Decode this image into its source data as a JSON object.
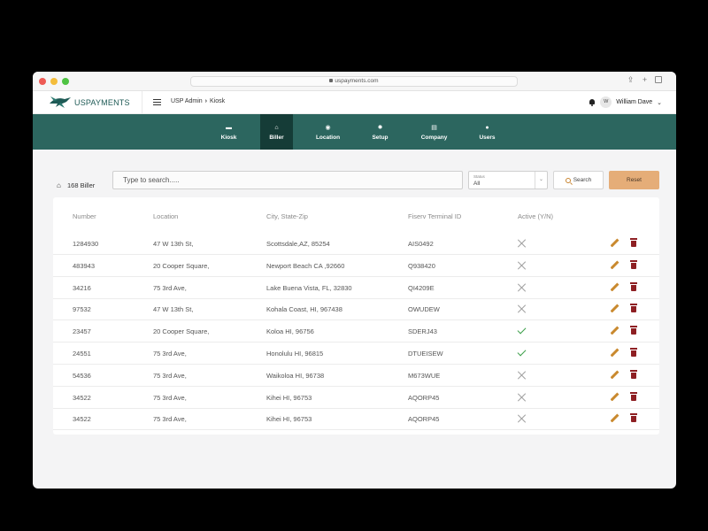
{
  "browser": {
    "url": "uspayments.com"
  },
  "header": {
    "logo_text": "USPAYMENTS",
    "breadcrumb": [
      "USP Admin",
      "Kiosk"
    ],
    "user": {
      "initial": "W",
      "name": "William Dave"
    }
  },
  "nav": {
    "items": [
      {
        "label": "Kiosk",
        "icon": "kiosk-icon",
        "active": false
      },
      {
        "label": "Biller",
        "icon": "bank-icon",
        "active": true
      },
      {
        "label": "Location",
        "icon": "location-icon",
        "active": false
      },
      {
        "label": "Setup",
        "icon": "setup-icon",
        "active": false
      },
      {
        "label": "Company",
        "icon": "company-icon",
        "active": false
      },
      {
        "label": "Users",
        "icon": "users-icon",
        "active": false
      }
    ]
  },
  "toolbar": {
    "biller_count": "168 Biller",
    "search_placeholder": "Type to search.....",
    "status_label": "Status",
    "status_value": "All",
    "search_button": "Search",
    "reset_button": "Reset"
  },
  "table": {
    "columns": [
      "Number",
      "Location",
      "City, State-Zip",
      "Fiserv Terminal ID",
      "Active (Y/N)"
    ],
    "rows": [
      {
        "number": "1284930",
        "location": "47 W 13th St,",
        "city": "Scottsdale,AZ, 85254",
        "terminal": "AIS0492",
        "active": false
      },
      {
        "number": "483943",
        "location": "20 Cooper Square,",
        "city": "Newport Beach CA ,92660",
        "terminal": "Q938420",
        "active": false
      },
      {
        "number": "34216",
        "location": "75 3rd Ave,",
        "city": "Lake Buena Vista, FL, 32830",
        "terminal": "QI4209E",
        "active": false
      },
      {
        "number": "97532",
        "location": "47 W 13th St,",
        "city": "Kohala Coast, HI, 967438",
        "terminal": "OWUDEW",
        "active": false
      },
      {
        "number": "23457",
        "location": "20 Cooper Square,",
        "city": "Koloa HI, 96756",
        "terminal": "SDERJ43",
        "active": true
      },
      {
        "number": "24551",
        "location": "75 3rd Ave,",
        "city": "Honolulu HI, 96815",
        "terminal": "DTUEISEW",
        "active": true
      },
      {
        "number": "54536",
        "location": "75 3rd Ave,",
        "city": "Waikoloa HI, 96738",
        "terminal": "M673WUE",
        "active": false
      },
      {
        "number": "34522",
        "location": "75 3rd Ave,",
        "city": "Kihei HI, 96753",
        "terminal": "AQORP45",
        "active": false
      },
      {
        "number": "34522",
        "location": "75 3rd Ave,",
        "city": "Kihei HI, 96753",
        "terminal": "AQORP45",
        "active": false
      }
    ]
  },
  "colors": {
    "brand": "#2c665f",
    "nav_active": "#153c37",
    "reset": "#e5ad78",
    "edit": "#c9892e",
    "delete": "#8e1f23",
    "check": "#3a9e48"
  }
}
